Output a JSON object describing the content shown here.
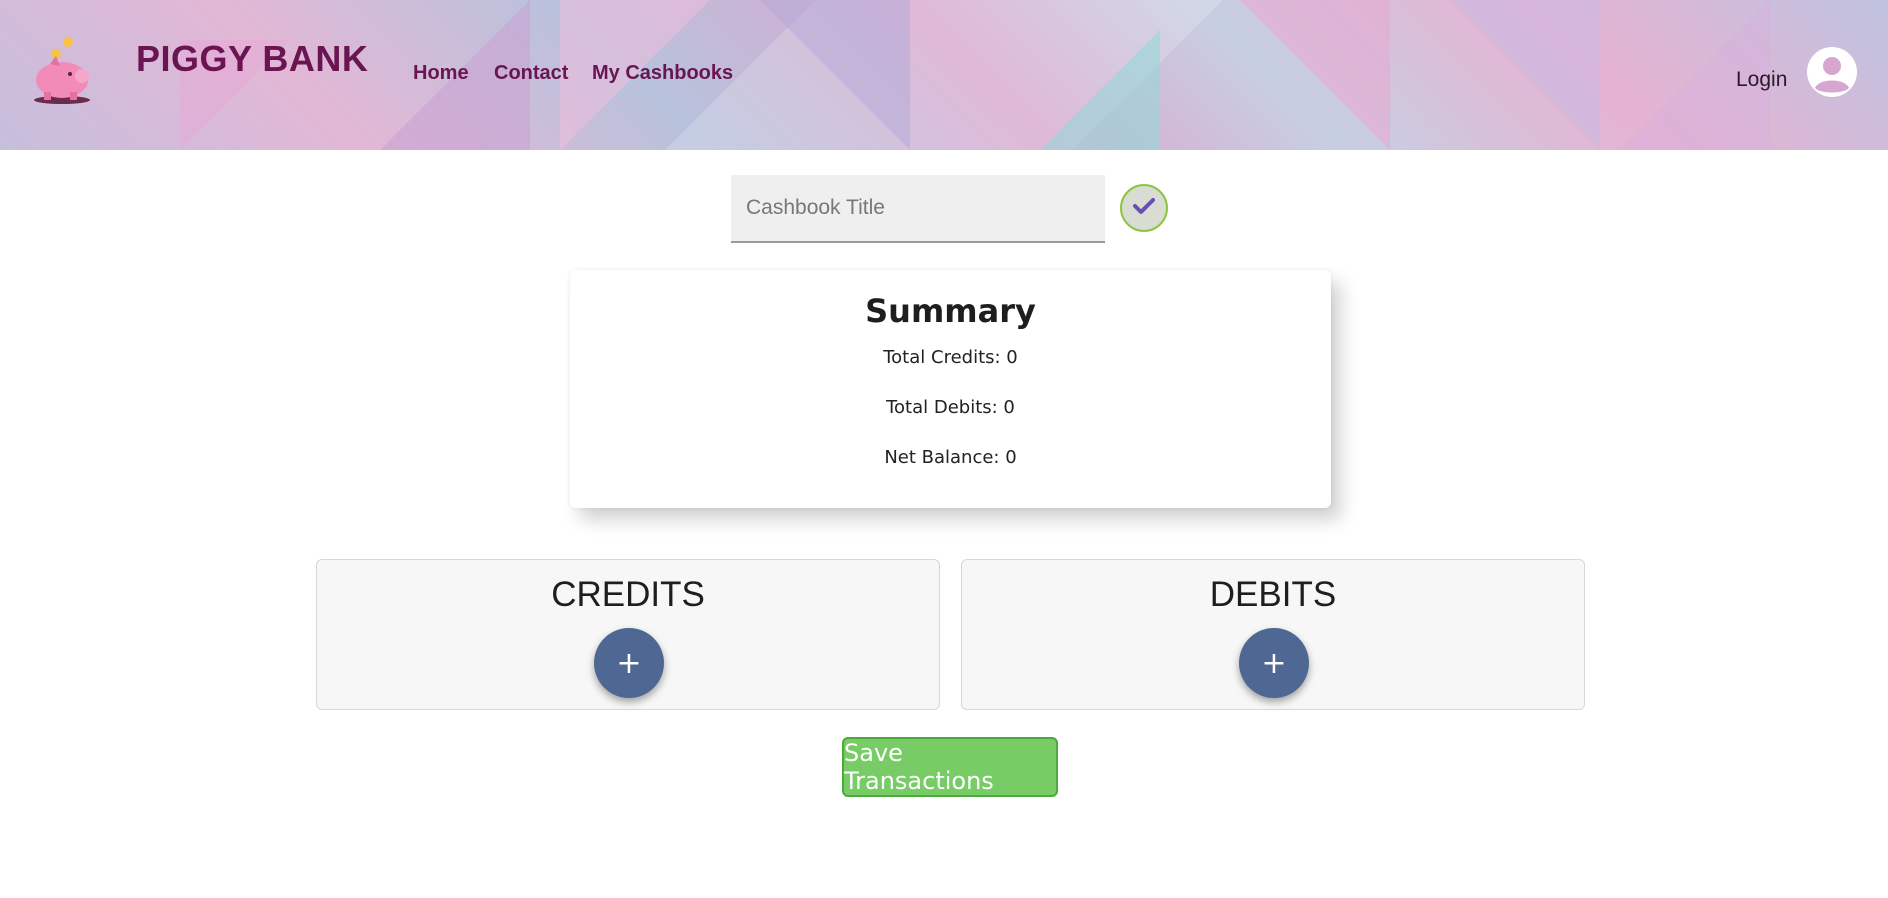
{
  "header": {
    "brand": "PIGGY BANK",
    "nav": {
      "home": "Home",
      "contact": "Contact",
      "my_cashbooks": "My Cashbooks"
    },
    "login_label": "Login",
    "brand_color": "#6a1552"
  },
  "cashbook": {
    "title_placeholder": "Cashbook Title",
    "title_value": ""
  },
  "summary": {
    "heading": "Summary",
    "total_credits": "Total Credits: 0",
    "total_debits": "Total Debits: 0",
    "net_balance": "Net Balance: 0"
  },
  "credits": {
    "heading": "CREDITS",
    "add_label": "+"
  },
  "debits": {
    "heading": "DEBITS",
    "add_label": "+"
  },
  "actions": {
    "save_label": "Save Transactions"
  },
  "icons": {
    "logo": "piggy-bank-logo-icon",
    "avatar": "user-avatar-icon",
    "confirm": "checkmark-icon"
  },
  "colors": {
    "add_button": "#4e6793",
    "save_button": "#77cc66",
    "confirm_border": "#8cc63f"
  }
}
